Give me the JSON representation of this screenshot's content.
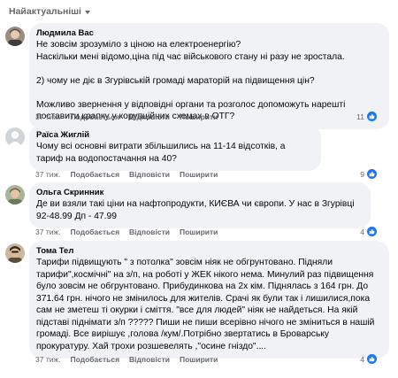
{
  "sort": {
    "label": "Найактуальніші"
  },
  "comments": [
    {
      "author": "Людмила Вас",
      "text": "Не зовсім зрозуміло з ціною на електроенергію?\nНаскільки мені відомо,ціна під час військового стану ні разу не зростала.\n\n2) чому не діє в Згурівській громаді мараторій на підвищення цін?\n\nМожливо звернення у відповідні органи та розголос допоможуть нарешті поставити крапку у корупційних схемах в ОТГ?",
      "time": "37 тиж.",
      "like_label": "Подобається",
      "reply_label": "Відповісти",
      "share_label": "Поширити",
      "reactions": "11"
    },
    {
      "author": "Раїса Жиглій",
      "text": "Чому всі основні витрати збільшились на 11-14 відсотків, а тариф на водопостачання на 40?",
      "time": "37 тиж.",
      "like_label": "Подобається",
      "reply_label": "Відповісти",
      "share_label": "Поширити",
      "reactions": "9"
    },
    {
      "author": "Ольга Скринник",
      "text": "Де ви взяли такі ціни на нафтопродукти, КИЄВА чи європи. У нас в Згурівці 92-48.99 Дп - 47.99",
      "time": "37 тиж.",
      "like_label": "Подобається",
      "reply_label": "Відповісти",
      "share_label": "Поширити",
      "reactions": "4"
    },
    {
      "author": "Тома Тел",
      "text": "Тарифи підвищують \" з потолка\" зовсім ніяк не обгрунтовано. Підняли тарифи\",космічні\" на з/п, на роботі у ЖЕК нікого нема. Минулий раз підвищення було зовсім не обгрунтовано. Прибудинкова на 2х кім. Піднялась з 164 грн. До 371.64 грн. нічого не змінилось для жителів. Срачі як були так і лишилися,пока сам не зметеш ті окурки і сміття. \"все для людей\" ніяк не найдеться. На якій підставі піднімати з/п ????? Пиши не пиши всерівно нічого не зміниться в нашій громаді. Все вирішує ,голова /кум/.Потрібно звертатись в Броварську прокуратуру. Хай трохи розшевелять ,\"осине гніздо\"....",
      "time": "37 тиж.",
      "like_label": "Подобається",
      "reply_label": "Відповісти",
      "share_label": "Поширити",
      "reactions": "4"
    }
  ]
}
